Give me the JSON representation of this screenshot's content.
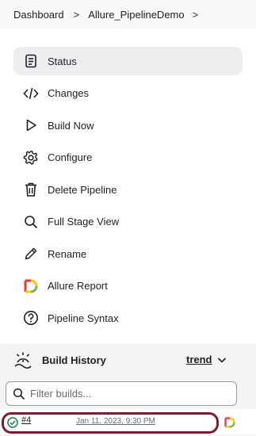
{
  "breadcrumb": {
    "items": [
      "Dashboard",
      "Allure_PipelineDemo"
    ],
    "separator": ">"
  },
  "menu": [
    {
      "label": "Status",
      "icon": "document-icon",
      "active": true
    },
    {
      "label": "Changes",
      "icon": "code-icon"
    },
    {
      "label": "Build Now",
      "icon": "play-icon"
    },
    {
      "label": "Configure",
      "icon": "gear-icon"
    },
    {
      "label": "Delete Pipeline",
      "icon": "trash-icon"
    },
    {
      "label": "Full Stage View",
      "icon": "search-icon"
    },
    {
      "label": "Rename",
      "icon": "pencil-icon"
    },
    {
      "label": "Allure Report",
      "icon": "allure-icon"
    },
    {
      "label": "Pipeline Syntax",
      "icon": "help-circle-icon"
    }
  ],
  "build_history": {
    "title": "Build History",
    "trend_label": "trend",
    "filter_placeholder": "Filter builds...",
    "builds": [
      {
        "number": "#4",
        "date": "Jan 11, 2023, 9:30 PM",
        "status": "success"
      }
    ]
  },
  "colors": {
    "active_bg": "#eeeef0",
    "success": "#138347",
    "highlight_ring": "#7a1d2e",
    "allure_red": "#e63c2f",
    "allure_yellow": "#f5c518",
    "allure_green": "#7cb342"
  }
}
